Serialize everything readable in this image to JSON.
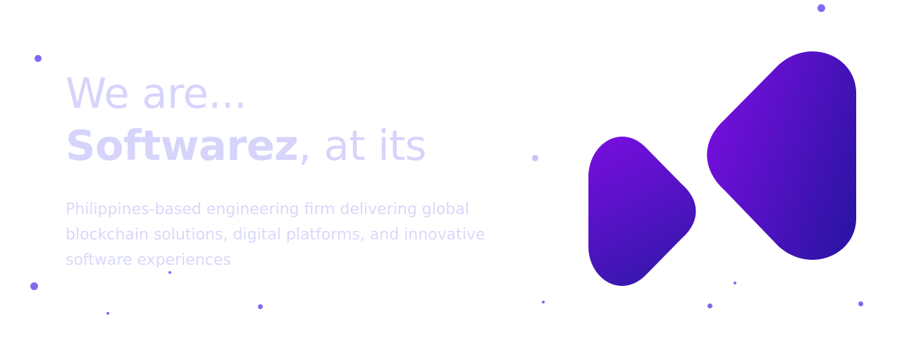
{
  "hero": {
    "headline_line1": "We are...",
    "headline_brand": "Softwarez",
    "headline_rest": ", at its",
    "tagline": "Philippines-based engineering firm delivering global blockchain solutions, digital platforms, and innovative software experiences"
  },
  "logo": {
    "icon": "softwarez-logo-icon",
    "gradient_start": "#7a0ee0",
    "gradient_end": "#2e14a6"
  },
  "colors": {
    "headline": "#d6d4fb",
    "tagline": "#d9d8fb",
    "dots": "#7c6cf0"
  }
}
